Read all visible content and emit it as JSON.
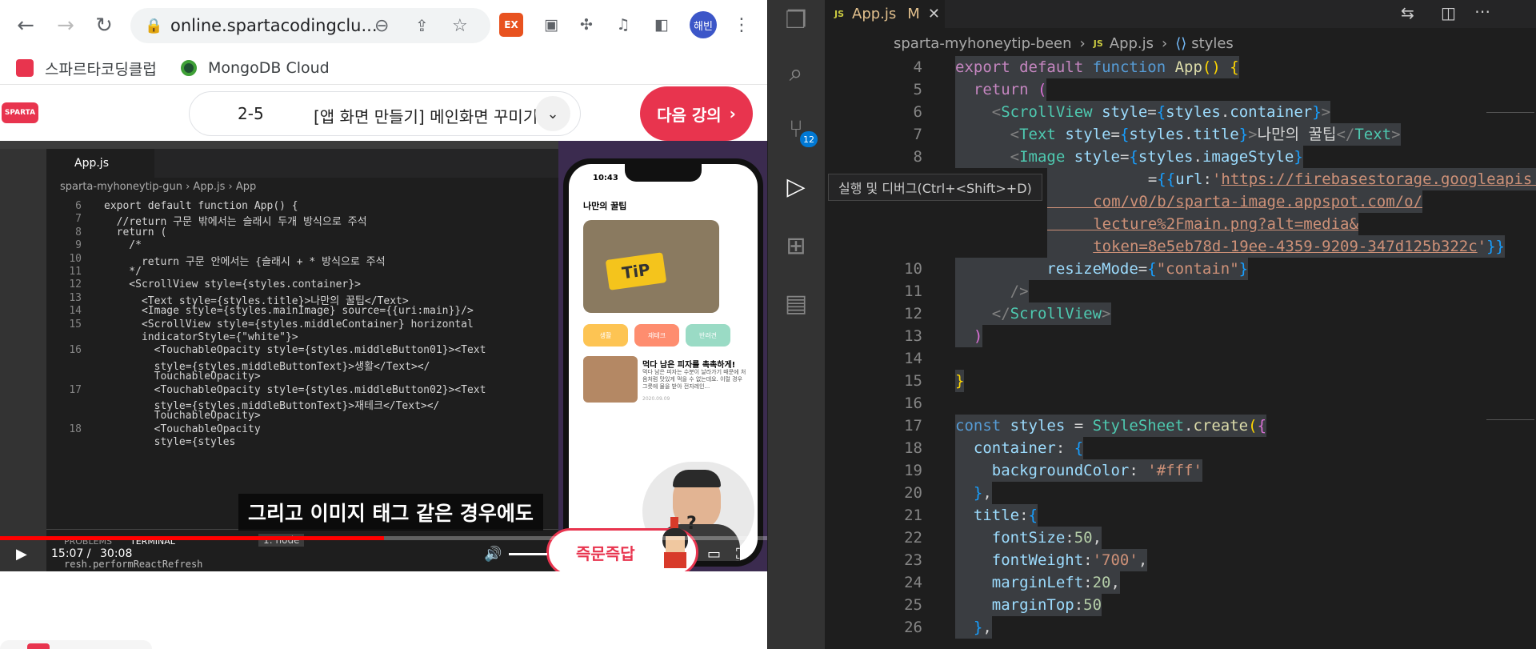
{
  "browser": {
    "url": "online.spartacodingclu...",
    "profile": "해빈",
    "bookmarks": [
      "스파르타코딩클럽",
      "MongoDB Cloud"
    ]
  },
  "course": {
    "lesson_number": "2-5",
    "lesson_title": "[앱 화면 만들기] 메인화면 꾸미기",
    "next_label": "다음 강의"
  },
  "video": {
    "caption": "그리고 이미지 태그 같은 경우에도",
    "time_current": "15:07 /",
    "time_total": "30:08",
    "progress": 0.5,
    "quick_answer": "즉문즉답",
    "editor_tab": "App.js",
    "editor_crumb": [
      "sparta-myhoneytip-gun",
      "App.js",
      "App"
    ],
    "terminal_tabs": [
      "PROBLEMS",
      "TERMINAL"
    ],
    "terminal_select": "1: node",
    "terminal_line": "resh.performReactRefresh",
    "phone": {
      "time": "10:43",
      "app_title": "나만의 꿀팁",
      "categories": [
        "생활",
        "재테크",
        "반려견"
      ],
      "card_title": "먹다 남은 피자를 촉촉하게!",
      "card_body": "먹다 남은 피자는 수분이 날라가기 때문에 처음처럼 맛있게 먹을 수 없는데요. 이럴 경우 그릇에 물을 받아 전자레인...",
      "card_date": "2020.09.09"
    },
    "code_lines": [
      {
        "n": "6",
        "t": "export default function App() {"
      },
      {
        "n": "7",
        "t": "  //return 구문 밖에서는 슬래시 두개 방식으로 주석"
      },
      {
        "n": "8",
        "t": "  return ("
      },
      {
        "n": "9",
        "t": "    /*"
      },
      {
        "n": "10",
        "t": "      return 구문 안에서는 {슬래시 + * 방식으로 주석"
      },
      {
        "n": "11",
        "t": "    */"
      },
      {
        "n": "12",
        "t": "    <ScrollView style={styles.container}>"
      },
      {
        "n": "13",
        "t": "      <Text style={styles.title}>나만의 꿀팁</Text>"
      },
      {
        "n": "14",
        "t": "      <Image style={styles.mainImage} source={{uri:main}}/>"
      },
      {
        "n": "15",
        "t": "      <ScrollView style={styles.middleContainer} horizontal"
      },
      {
        "n": "",
        "t": "      indicatorStyle={\"white\"}>"
      },
      {
        "n": "16",
        "t": "        <TouchableOpacity style={styles.middleButton01}><Text"
      },
      {
        "n": "",
        "t": "        style={styles.middleButtonText}>생활</Text></"
      },
      {
        "n": "",
        "t": "        TouchableOpacity>"
      },
      {
        "n": "17",
        "t": "        <TouchableOpacity style={styles.middleButton02}><Text"
      },
      {
        "n": "",
        "t": "        style={styles.middleButtonText}>재테크</Text></"
      },
      {
        "n": "",
        "t": "        TouchableOpacity>"
      },
      {
        "n": "18",
        "t": "        <TouchableOpacity"
      },
      {
        "n": "",
        "t": "        style={styles"
      }
    ]
  },
  "vscode": {
    "tab_name": "App.js",
    "tab_status": "M",
    "breadcrumb_folder": "sparta-myhoneytip-been",
    "breadcrumb_file": "App.js",
    "breadcrumb_symbol": "styles",
    "scm_badge": "12",
    "tooltip": "실행 및 디버그(Ctrl+<Shift>+D)"
  },
  "colors": {
    "accent": "#e8344e",
    "vscode_bg": "#1e1e1e",
    "progress": "#ff0000"
  }
}
